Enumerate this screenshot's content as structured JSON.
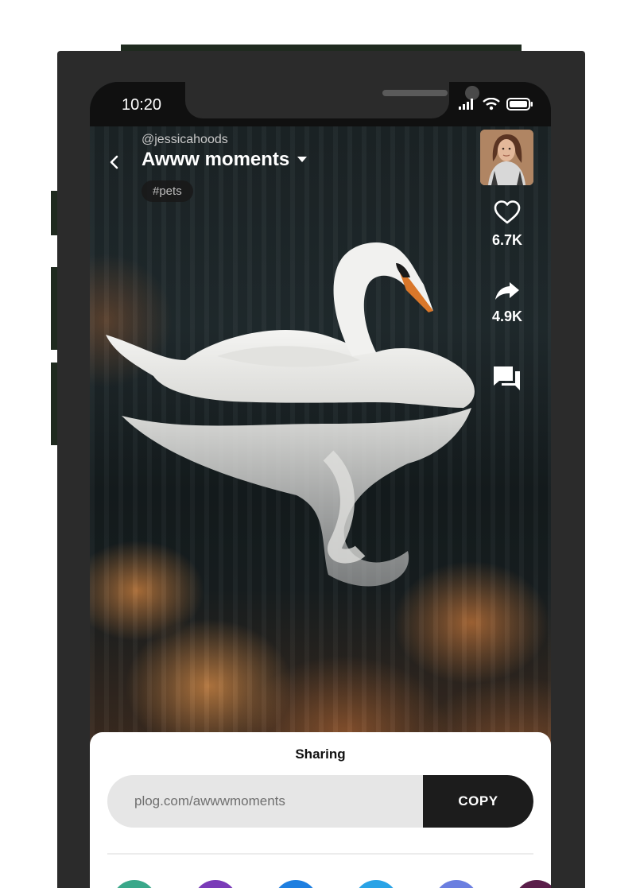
{
  "status_bar": {
    "time": "10:20"
  },
  "post": {
    "username": "@jessicahoods",
    "title": "Awww moments",
    "tag": "#pets"
  },
  "actions": {
    "likes": "6.7K",
    "shares": "4.9K"
  },
  "share_sheet": {
    "title": "Sharing",
    "link": "plog.com/awwwmoments",
    "copy_label": "COPY",
    "app_colors": [
      "#3aa88a",
      "#7a3bb8",
      "#1e7fe0",
      "#2aa3e6",
      "#6b7fe0",
      "#5a1e4a"
    ]
  },
  "colors": {
    "phone_frame": "#2b2b2b",
    "copy_button": "#1c1c1c",
    "link_bar": "#e6e6e6"
  }
}
